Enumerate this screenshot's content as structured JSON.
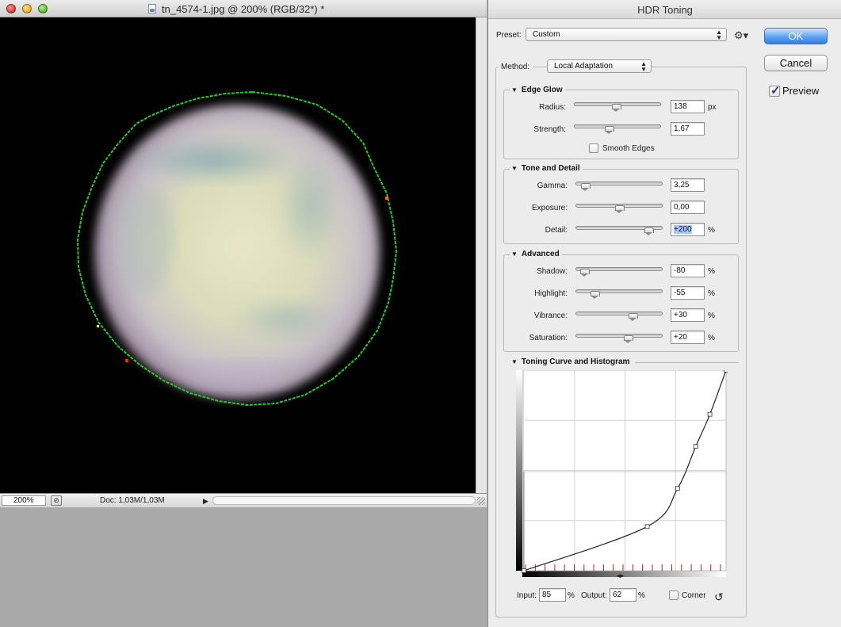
{
  "document": {
    "title": "tn_4574-1.jpg @ 200% (RGB/32*) *",
    "zoom": "200%",
    "doc_info": "Doc: 1,03M/1,03M"
  },
  "dialog": {
    "title": "HDR Toning",
    "preset_label": "Preset:",
    "preset_value": "Custom",
    "method_label": "Method:",
    "method_value": "Local Adaptation",
    "ok_label": "OK",
    "cancel_label": "Cancel",
    "preview_label": "Preview",
    "preview_checked": true,
    "edge_glow": {
      "title": "Edge Glow",
      "radius_label": "Radius:",
      "radius_value": "138",
      "radius_unit": "px",
      "radius_level": 0.48,
      "strength_label": "Strength:",
      "strength_value": "1,67",
      "strength_level": 0.4,
      "smooth_edges_label": "Smooth Edges",
      "smooth_edges_checked": false
    },
    "tone_detail": {
      "title": "Tone and Detail",
      "gamma_label": "Gamma:",
      "gamma_value": "3,25",
      "gamma_level": 0.11,
      "exposure_label": "Exposure:",
      "exposure_value": "0,00",
      "exposure_level": 0.5,
      "detail_label": "Detail:",
      "detail_value": "+200",
      "detail_unit": "%",
      "detail_level": 0.84
    },
    "advanced": {
      "title": "Advanced",
      "shadow_label": "Shadow:",
      "shadow_value": "-80",
      "shadow_level": 0.1,
      "highlight_label": "Highlight:",
      "highlight_value": "-55",
      "highlight_level": 0.22,
      "vibrance_label": "Vibrance:",
      "vibrance_value": "+30",
      "vibrance_level": 0.65,
      "saturation_label": "Saturation:",
      "saturation_value": "+20",
      "saturation_level": 0.6,
      "unit": "%"
    },
    "curve": {
      "title": "Toning Curve and Histogram",
      "input_label": "Input:",
      "input_value": "85",
      "output_label": "Output:",
      "output_value": "62",
      "unit": "%",
      "corner_label": "Corner",
      "corner_checked": false,
      "points": [
        [
          0,
          0
        ],
        [
          61,
          22
        ],
        [
          76,
          41
        ],
        [
          85,
          62
        ],
        [
          92,
          78
        ],
        [
          100,
          100
        ]
      ]
    }
  },
  "colors": {
    "accent": "#2f7fe2",
    "selection_outline": "#22cc22"
  },
  "icons": {
    "gear": "gear-icon",
    "reset": "reset-curve-icon"
  }
}
